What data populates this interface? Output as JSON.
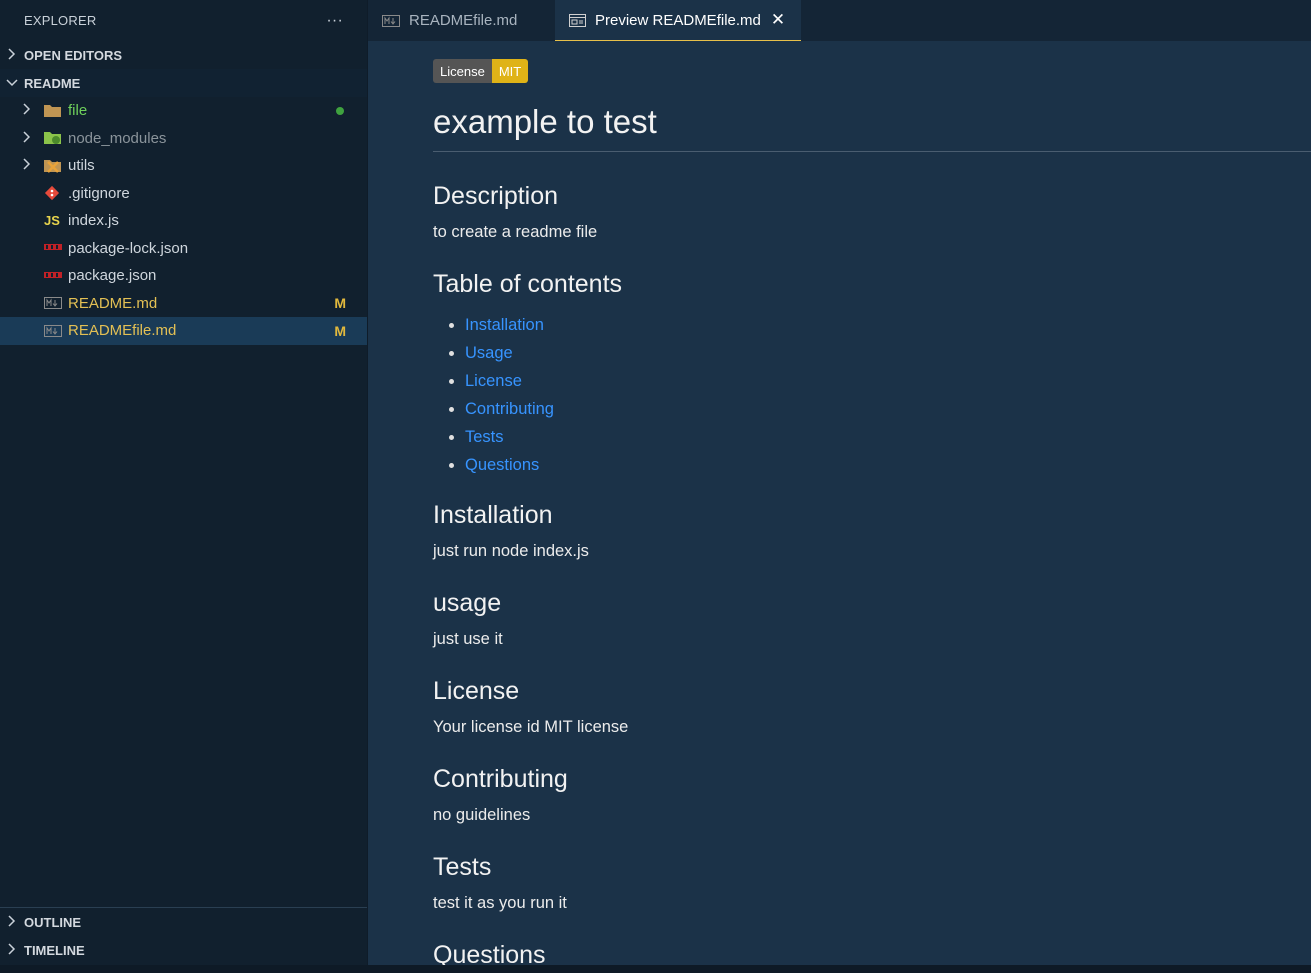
{
  "explorer": {
    "title": "EXPLORER",
    "more": "···",
    "sections": {
      "open_editors": "OPEN EDITORS",
      "readme": "README",
      "outline": "OUTLINE",
      "timeline": "TIMELINE"
    },
    "items": [
      {
        "label": "file",
        "badge": ""
      },
      {
        "label": "node_modules",
        "badge": ""
      },
      {
        "label": "utils",
        "badge": ""
      },
      {
        "label": ".gitignore",
        "badge": ""
      },
      {
        "label": "index.js",
        "badge": ""
      },
      {
        "label": "package-lock.json",
        "badge": ""
      },
      {
        "label": "package.json",
        "badge": ""
      },
      {
        "label": "README.md",
        "badge": "M"
      },
      {
        "label": "READMEfile.md",
        "badge": "M"
      }
    ],
    "js_icon": "JS"
  },
  "tabs": [
    {
      "label": "READMEfile.md"
    },
    {
      "label": "Preview READMEfile.md",
      "close": "✕"
    }
  ],
  "preview": {
    "license_badge": {
      "left": "License",
      "right": "MIT"
    },
    "title": "example to test",
    "description_heading": "Description",
    "description_text": "to create a readme file",
    "toc_heading": "Table of contents",
    "toc": [
      "Installation",
      "Usage",
      "License",
      "Contributing",
      "Tests",
      "Questions"
    ],
    "installation_heading": "Installation",
    "installation_text": "just run node index.js",
    "usage_heading": "usage",
    "usage_text": "just use it",
    "license_heading": "License",
    "license_text": "Your license id MIT license",
    "contributing_heading": "Contributing",
    "contributing_text": "no guidelines",
    "tests_heading": "Tests",
    "tests_text": "test it as you run it",
    "questions_heading": "Questions"
  },
  "colors": {
    "accent_link": "#3794ff",
    "modified": "#e2b93d",
    "untracked": "#6fd05b",
    "active_tab_border": "#e7c04a",
    "badge_mit": "#dfb317"
  },
  "icons": [
    "folder-icon",
    "node-folder-icon",
    "utils-folder-icon",
    "git-icon",
    "js-icon",
    "npm-icon",
    "markdown-icon",
    "preview-icon",
    "close-icon",
    "chevron-right-icon",
    "chevron-down-icon"
  ]
}
